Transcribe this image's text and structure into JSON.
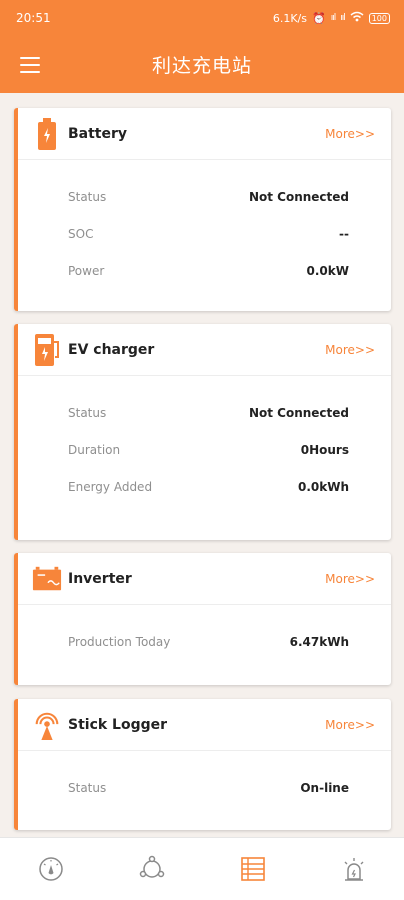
{
  "status_bar": {
    "time": "20:51",
    "speed": "6.1K/s",
    "signal1": "ııl",
    "signal2": "ııl",
    "battery": "100"
  },
  "header": {
    "title": "利达充电站"
  },
  "cards": [
    {
      "title": "Battery",
      "more": "More>>",
      "icon": "battery-icon",
      "rows": [
        {
          "label": "Status",
          "value": "Not Connected"
        },
        {
          "label": "SOC",
          "value": "--"
        },
        {
          "label": "Power",
          "value": "0.0kW"
        }
      ]
    },
    {
      "title": "EV charger",
      "more": "More>>",
      "icon": "ev-charger-icon",
      "rows": [
        {
          "label": "Status",
          "value": "Not Connected"
        },
        {
          "label": "Duration",
          "value": "0Hours"
        },
        {
          "label": "Energy Added",
          "value": "0.0kWh"
        }
      ]
    },
    {
      "title": "Inverter",
      "more": "More>>",
      "icon": "inverter-icon",
      "rows": [
        {
          "label": "Production Today",
          "value": "6.47kWh"
        }
      ]
    },
    {
      "title": "Stick Logger",
      "more": "More>>",
      "icon": "antenna-icon",
      "rows": [
        {
          "label": "Status",
          "value": "On-line"
        }
      ]
    }
  ],
  "bottom_nav": [
    {
      "icon": "gauge-icon",
      "active": false
    },
    {
      "icon": "network-icon",
      "active": false
    },
    {
      "icon": "list-icon",
      "active": true
    },
    {
      "icon": "alarm-icon",
      "active": false
    }
  ],
  "colors": {
    "accent": "#f7853a",
    "inactive": "#8a8a8a"
  }
}
